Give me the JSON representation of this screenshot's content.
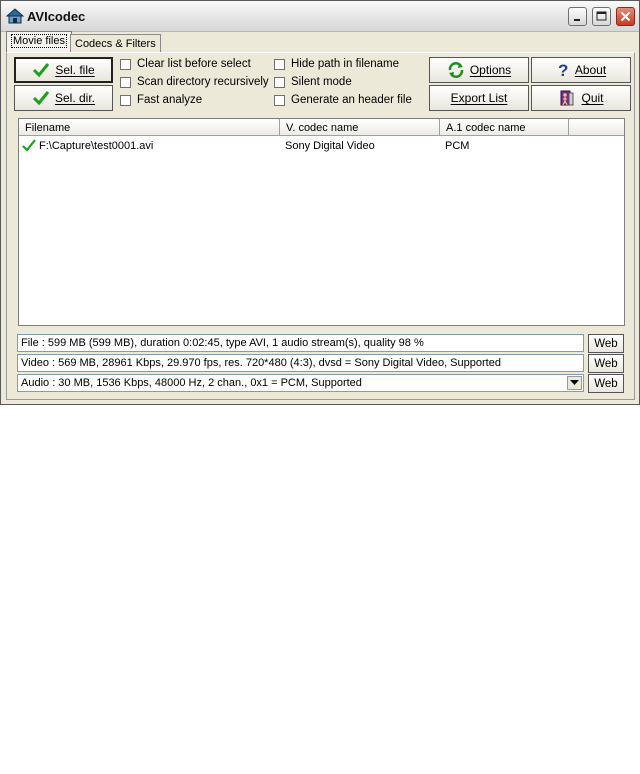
{
  "window": {
    "title": "AVIcodec"
  },
  "tabs": [
    {
      "label": "Movie files",
      "active": true
    },
    {
      "label": "Codecs & Filters",
      "active": false
    }
  ],
  "buttons": {
    "sel_file": "Sel. file",
    "sel_dir": "Sel. dir.",
    "options": "Options",
    "about": "About",
    "export_list": "Export List",
    "quit": "Quit"
  },
  "checkboxes": [
    {
      "label": "Clear list before select",
      "checked": false
    },
    {
      "label": "Scan directory recursively",
      "checked": false
    },
    {
      "label": "Fast analyze",
      "checked": false
    },
    {
      "label": "Hide path in filename",
      "checked": false
    },
    {
      "label": "Silent mode",
      "checked": false
    },
    {
      "label": "Generate an header file",
      "checked": false
    }
  ],
  "file_list": {
    "columns": [
      "Filename",
      "V. codec name",
      "A.1 codec name"
    ],
    "rows": [
      {
        "filename": "F:\\Capture\\test0001.avi",
        "video_codec": "Sony Digital Video",
        "audio_codec": "PCM",
        "status": "ok"
      }
    ]
  },
  "info": {
    "file": "File : 599 MB (599 MB), duration 0:02:45, type AVI, 1 audio stream(s), quality 98 %",
    "video": "Video : 569 MB, 28961 Kbps, 29.970 fps, res. 720*480 (4:3),  dvsd = Sony Digital Video, Supported",
    "audio": "Audio : 30 MB, 1536 Kbps, 48000 Hz, 2 chan., 0x1 = PCM, Supported",
    "web_label": "Web"
  },
  "colors": {
    "check_green": "#1e9e1e",
    "close_red": "#c63c22",
    "window_bg": "#ece9d8"
  }
}
